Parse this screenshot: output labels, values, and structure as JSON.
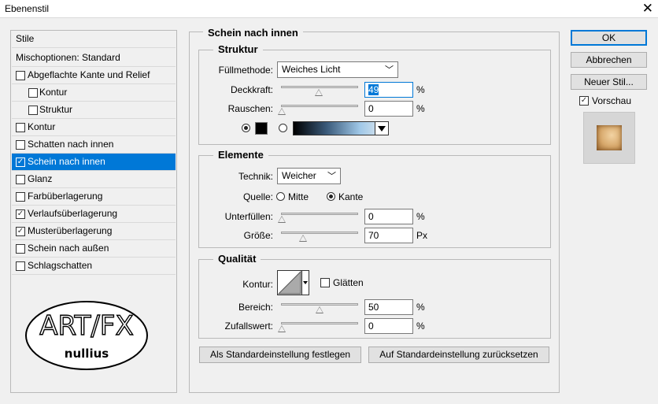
{
  "window": {
    "title": "Ebenenstil",
    "close_glyph": "✕"
  },
  "left": {
    "header": "Stile",
    "blend_options": "Mischoptionen: Standard",
    "items": [
      {
        "label": "Abgeflachte Kante und Relief",
        "checked": false,
        "indent": false
      },
      {
        "label": "Kontur",
        "checked": false,
        "indent": true
      },
      {
        "label": "Struktur",
        "checked": false,
        "indent": true
      },
      {
        "label": "Kontur",
        "checked": false,
        "indent": false
      },
      {
        "label": "Schatten nach innen",
        "checked": false,
        "indent": false
      },
      {
        "label": "Schein nach innen",
        "checked": true,
        "indent": false,
        "selected": true
      },
      {
        "label": "Glanz",
        "checked": false,
        "indent": false
      },
      {
        "label": "Farbüberlagerung",
        "checked": false,
        "indent": false
      },
      {
        "label": "Verlaufsüberlagerung",
        "checked": true,
        "indent": false
      },
      {
        "label": "Musterüberlagerung",
        "checked": true,
        "indent": false
      },
      {
        "label": "Schein nach außen",
        "checked": false,
        "indent": false
      },
      {
        "label": "Schlagschatten",
        "checked": false,
        "indent": false
      }
    ],
    "logo": {
      "line1": "ART/FX",
      "line2": "nullius"
    }
  },
  "main": {
    "title": "Schein nach innen",
    "struktur": {
      "title": "Struktur",
      "blend_label": "Füllmethode:",
      "blend_value": "Weiches Licht",
      "opacity_label": "Deckkraft:",
      "opacity_value": "49",
      "opacity_level": 0.49,
      "noise_label": "Rauschen:",
      "noise_value": "0",
      "noise_level": 0,
      "percent": "%",
      "color_hex": "#000000"
    },
    "elemente": {
      "title": "Elemente",
      "technique_label": "Technik:",
      "technique_value": "Weicher",
      "source_label": "Quelle:",
      "source_center": "Mitte",
      "source_edge": "Kante",
      "choke_label": "Unterfüllen:",
      "choke_value": "0",
      "choke_level": 0,
      "size_label": "Größe:",
      "size_value": "70",
      "size_level": 0.28,
      "percent": "%",
      "px": "Px"
    },
    "qualitaet": {
      "title": "Qualität",
      "contour_label": "Kontur:",
      "smooth_label": "Glätten",
      "range_label": "Bereich:",
      "range_value": "50",
      "range_level": 0.5,
      "jitter_label": "Zufallswert:",
      "jitter_value": "0",
      "jitter_level": 0,
      "percent": "%"
    },
    "btn_set_default": "Als Standardeinstellung festlegen",
    "btn_reset_default": "Auf Standardeinstellung zurücksetzen"
  },
  "right": {
    "ok": "OK",
    "cancel": "Abbrechen",
    "new_style": "Neuer Stil...",
    "preview_label": "Vorschau",
    "preview_checked": true
  },
  "colors": {
    "accent": "#0078d7",
    "preview_tan": "#c99a5e"
  }
}
